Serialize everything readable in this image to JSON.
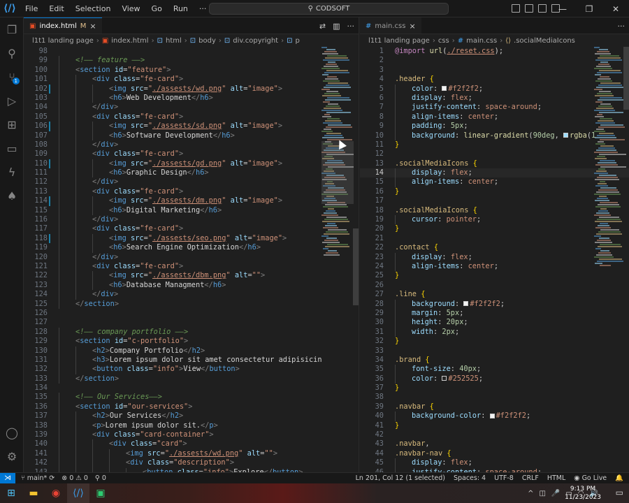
{
  "titlebar": {
    "menu": [
      "File",
      "Edit",
      "Selection",
      "View",
      "Go",
      "Run",
      "···"
    ],
    "search": "CODSOFT",
    "window_controls": [
      "—",
      "❐",
      "✕"
    ]
  },
  "activity": {
    "scm_badge": "1"
  },
  "left_editor": {
    "tab": {
      "label": "index.html",
      "modified": "M"
    },
    "breadcrumbs": [
      "l1t1 landing page",
      "index.html",
      "html",
      "body",
      "div.copyright",
      "p"
    ],
    "lines": [
      {
        "n": "98",
        "html": ""
      },
      {
        "n": "99",
        "html": "<span class='tk-com'>&lt;!—— feature ——&gt;</span>",
        "indent": 1
      },
      {
        "n": "100",
        "html": "<span class='tk-br'>&lt;</span><span class='tk-tag'>section</span> <span class='tk-attr'>id</span>=<span class='tk-str'>\"feature\"</span><span class='tk-br'>&gt;</span>",
        "indent": 1
      },
      {
        "n": "101",
        "html": "<span class='tk-br'>&lt;</span><span class='tk-tag'>div</span> <span class='tk-attr'>class</span>=<span class='tk-str'>\"fe-card\"</span><span class='tk-br'>&gt;</span>",
        "indent": 2
      },
      {
        "n": "102",
        "html": "<span class='tk-br'>&lt;</span><span class='tk-tag'>img</span> <span class='tk-attr'>src</span>=<span class='tk-str'>\"</span><span class='tk-link'>./assests/wd.png</span><span class='tk-str'>\"</span> <span class='tk-attr'>alt</span>=<span class='tk-str'>\"image\"</span><span class='tk-br'>&gt;</span>",
        "indent": 3,
        "mod": true
      },
      {
        "n": "103",
        "html": "<span class='tk-br'>&lt;</span><span class='tk-tag'>h6</span><span class='tk-br'>&gt;</span><span class='tk-text'>Web Development</span><span class='tk-br'>&lt;/</span><span class='tk-tag'>h6</span><span class='tk-br'>&gt;</span>",
        "indent": 3
      },
      {
        "n": "104",
        "html": "<span class='tk-br'>&lt;/</span><span class='tk-tag'>div</span><span class='tk-br'>&gt;</span>",
        "indent": 2
      },
      {
        "n": "105",
        "html": "<span class='tk-br'>&lt;</span><span class='tk-tag'>div</span> <span class='tk-attr'>class</span>=<span class='tk-str'>\"fe-card\"</span><span class='tk-br'>&gt;</span>",
        "indent": 2
      },
      {
        "n": "106",
        "html": "<span class='tk-br'>&lt;</span><span class='tk-tag'>img</span> <span class='tk-attr'>src</span>=<span class='tk-str'>\"</span><span class='tk-link'>./assests/sd.png</span><span class='tk-str'>\"</span> <span class='tk-attr'>alt</span>=<span class='tk-str'>\"image\"</span><span class='tk-br'>&gt;</span>",
        "indent": 3,
        "mod": true
      },
      {
        "n": "107",
        "html": "<span class='tk-br'>&lt;</span><span class='tk-tag'>h6</span><span class='tk-br'>&gt;</span><span class='tk-text'>Software Development</span><span class='tk-br'>&lt;/</span><span class='tk-tag'>h6</span><span class='tk-br'>&gt;</span>",
        "indent": 3
      },
      {
        "n": "108",
        "html": "<span class='tk-br'>&lt;/</span><span class='tk-tag'>div</span><span class='tk-br'>&gt;</span>",
        "indent": 2
      },
      {
        "n": "109",
        "html": "<span class='tk-br'>&lt;</span><span class='tk-tag'>div</span> <span class='tk-attr'>class</span>=<span class='tk-str'>\"fe-card\"</span><span class='tk-br'>&gt;</span>",
        "indent": 2
      },
      {
        "n": "110",
        "html": "<span class='tk-br'>&lt;</span><span class='tk-tag'>img</span> <span class='tk-attr'>src</span>=<span class='tk-str'>\"</span><span class='tk-link'>./assests/gd.png</span><span class='tk-str'>\"</span> <span class='tk-attr'>alt</span>=<span class='tk-str'>\"image\"</span><span class='tk-br'>&gt;</span>",
        "indent": 3,
        "mod": true
      },
      {
        "n": "111",
        "html": "<span class='tk-br'>&lt;</span><span class='tk-tag'>h6</span><span class='tk-br'>&gt;</span><span class='tk-text'>Graphic Design</span><span class='tk-br'>&lt;/</span><span class='tk-tag'>h6</span><span class='tk-br'>&gt;</span>",
        "indent": 3
      },
      {
        "n": "112",
        "html": "<span class='tk-br'>&lt;/</span><span class='tk-tag'>div</span><span class='tk-br'>&gt;</span>",
        "indent": 2
      },
      {
        "n": "113",
        "html": "<span class='tk-br'>&lt;</span><span class='tk-tag'>div</span> <span class='tk-attr'>class</span>=<span class='tk-str'>\"fe-card\"</span><span class='tk-br'>&gt;</span>",
        "indent": 2
      },
      {
        "n": "114",
        "html": "<span class='tk-br'>&lt;</span><span class='tk-tag'>img</span> <span class='tk-attr'>src</span>=<span class='tk-str'>\"</span><span class='tk-link'>./assests/dm.png</span><span class='tk-str'>\"</span> <span class='tk-attr'>alt</span>=<span class='tk-str'>\"image\"</span><span class='tk-br'>&gt;</span>",
        "indent": 3,
        "mod": true
      },
      {
        "n": "115",
        "html": "<span class='tk-br'>&lt;</span><span class='tk-tag'>h6</span><span class='tk-br'>&gt;</span><span class='tk-text'>Digital Marketing</span><span class='tk-br'>&lt;/</span><span class='tk-tag'>h6</span><span class='tk-br'>&gt;</span>",
        "indent": 3
      },
      {
        "n": "116",
        "html": "<span class='tk-br'>&lt;/</span><span class='tk-tag'>div</span><span class='tk-br'>&gt;</span>",
        "indent": 2
      },
      {
        "n": "117",
        "html": "<span class='tk-br'>&lt;</span><span class='tk-tag'>div</span> <span class='tk-attr'>class</span>=<span class='tk-str'>\"fe-card\"</span><span class='tk-br'>&gt;</span>",
        "indent": 2
      },
      {
        "n": "118",
        "html": "<span class='tk-br'>&lt;</span><span class='tk-tag'>img</span> <span class='tk-attr'>src</span>=<span class='tk-str'>\"</span><span class='tk-link'>./assests/seo.png</span><span class='tk-str'>\"</span> <span class='tk-attr'>alt</span>=<span class='tk-str'>\"image\"</span><span class='tk-br'>&gt;</span>",
        "indent": 3,
        "mod": true
      },
      {
        "n": "119",
        "html": "<span class='tk-br'>&lt;</span><span class='tk-tag'>h6</span><span class='tk-br'>&gt;</span><span class='tk-text'>Search Engine Optimization</span><span class='tk-br'>&lt;/</span><span class='tk-tag'>h6</span><span class='tk-br'>&gt;</span>",
        "indent": 3
      },
      {
        "n": "120",
        "html": "<span class='tk-br'>&lt;/</span><span class='tk-tag'>div</span><span class='tk-br'>&gt;</span>",
        "indent": 2
      },
      {
        "n": "121",
        "html": "<span class='tk-br'>&lt;</span><span class='tk-tag'>div</span> <span class='tk-attr'>class</span>=<span class='tk-str'>\"fe-card\"</span><span class='tk-br'>&gt;</span>",
        "indent": 2
      },
      {
        "n": "122",
        "html": "<span class='tk-br'>&lt;</span><span class='tk-tag'>img</span> <span class='tk-attr'>src</span>=<span class='tk-str'>\"</span><span class='tk-link'>./assests/dbm.png</span><span class='tk-str'>\"</span> <span class='tk-attr'>alt</span>=<span class='tk-str'>\"\"</span><span class='tk-br'>&gt;</span>",
        "indent": 3
      },
      {
        "n": "123",
        "html": "<span class='tk-br'>&lt;</span><span class='tk-tag'>h6</span><span class='tk-br'>&gt;</span><span class='tk-text'>Database Managment</span><span class='tk-br'>&lt;/</span><span class='tk-tag'>h6</span><span class='tk-br'>&gt;</span>",
        "indent": 3
      },
      {
        "n": "124",
        "html": "<span class='tk-br'>&lt;/</span><span class='tk-tag'>div</span><span class='tk-br'>&gt;</span>",
        "indent": 2
      },
      {
        "n": "125",
        "html": "<span class='tk-br'>&lt;/</span><span class='tk-tag'>section</span><span class='tk-br'>&gt;</span>",
        "indent": 1
      },
      {
        "n": "126",
        "html": ""
      },
      {
        "n": "127",
        "html": ""
      },
      {
        "n": "128",
        "html": "<span class='tk-com'>&lt;!—— company portfolio ——&gt;</span>",
        "indent": 1
      },
      {
        "n": "129",
        "html": "<span class='tk-br'>&lt;</span><span class='tk-tag'>section</span> <span class='tk-attr'>id</span>=<span class='tk-str'>\"c-portfolio\"</span><span class='tk-br'>&gt;</span>",
        "indent": 1
      },
      {
        "n": "130",
        "html": "<span class='tk-br'>&lt;</span><span class='tk-tag'>h2</span><span class='tk-br'>&gt;</span><span class='tk-text'>Company Portfolio</span><span class='tk-br'>&lt;/</span><span class='tk-tag'>h2</span><span class='tk-br'>&gt;</span>",
        "indent": 2
      },
      {
        "n": "131",
        "html": "<span class='tk-br'>&lt;</span><span class='tk-tag'>h3</span><span class='tk-br'>&gt;</span><span class='tk-text'>Lorem ipsum dolor sit amet consectetur adipisicin</span>",
        "indent": 2
      },
      {
        "n": "132",
        "html": "<span class='tk-br'>&lt;</span><span class='tk-tag'>button</span> <span class='tk-attr'>class</span>=<span class='tk-str'>\"info\"</span><span class='tk-br'>&gt;</span><span class='tk-text'>View</span><span class='tk-br'>&lt;/</span><span class='tk-tag'>button</span><span class='tk-br'>&gt;</span>",
        "indent": 2
      },
      {
        "n": "133",
        "html": "<span class='tk-br'>&lt;/</span><span class='tk-tag'>section</span><span class='tk-br'>&gt;</span>",
        "indent": 1
      },
      {
        "n": "134",
        "html": ""
      },
      {
        "n": "135",
        "html": "<span class='tk-com'>&lt;!—— Our Services——&gt;</span>",
        "indent": 1
      },
      {
        "n": "136",
        "html": "<span class='tk-br'>&lt;</span><span class='tk-tag'>section</span> <span class='tk-attr'>id</span>=<span class='tk-str'>\"our-services\"</span><span class='tk-br'>&gt;</span>",
        "indent": 1
      },
      {
        "n": "137",
        "html": "<span class='tk-br'>&lt;</span><span class='tk-tag'>h2</span><span class='tk-br'>&gt;</span><span class='tk-text'>Our Services</span><span class='tk-br'>&lt;/</span><span class='tk-tag'>h2</span><span class='tk-br'>&gt;</span>",
        "indent": 2
      },
      {
        "n": "138",
        "html": "<span class='tk-br'>&lt;</span><span class='tk-tag'>p</span><span class='tk-br'>&gt;</span><span class='tk-text'>Lorem ipsum dolor sit.</span><span class='tk-br'>&lt;/</span><span class='tk-tag'>p</span><span class='tk-br'>&gt;</span>",
        "indent": 2
      },
      {
        "n": "139",
        "html": "<span class='tk-br'>&lt;</span><span class='tk-tag'>div</span> <span class='tk-attr'>class</span>=<span class='tk-str'>\"card-container\"</span><span class='tk-br'>&gt;</span>",
        "indent": 2
      },
      {
        "n": "140",
        "html": "<span class='tk-br'>&lt;</span><span class='tk-tag'>div</span> <span class='tk-attr'>class</span>=<span class='tk-str'>\"card\"</span><span class='tk-br'>&gt;</span>",
        "indent": 3
      },
      {
        "n": "141",
        "html": "<span class='tk-br'>&lt;</span><span class='tk-tag'>img</span> <span class='tk-attr'>src</span>=<span class='tk-str'>\"</span><span class='tk-link'>./assests/wd.png</span><span class='tk-str'>\"</span> <span class='tk-attr'>alt</span>=<span class='tk-str'>\"\"</span><span class='tk-br'>&gt;</span>",
        "indent": 4
      },
      {
        "n": "142",
        "html": "<span class='tk-br'>&lt;</span><span class='tk-tag'>div</span> <span class='tk-attr'>class</span>=<span class='tk-str'>\"description\"</span><span class='tk-br'>&gt;</span>",
        "indent": 4
      },
      {
        "n": "143",
        "html": "<span class='tk-br'>&lt;</span><span class='tk-tag'>button</span> <span class='tk-attr'>class</span>=<span class='tk-str'>\"info\"</span><span class='tk-br'>&gt;</span><span class='tk-text'>Explore</span><span class='tk-br'>&lt;/</span><span class='tk-tag'>button</span><span class='tk-br'>&gt;</span>",
        "indent": 5
      }
    ]
  },
  "right_editor": {
    "tab": {
      "label": "main.css"
    },
    "breadcrumbs": [
      "l1t1 landing page",
      "css",
      "main.css",
      ".socialMediaIcons"
    ],
    "lines": [
      {
        "n": "1",
        "html": "<span class='tk-at'>@import</span> <span class='tk-fn'>url</span><span class='tk-punc'>(</span><span class='tk-link'>./reset.css</span><span class='tk-punc'>);</span>"
      },
      {
        "n": "2",
        "html": ""
      },
      {
        "n": "3",
        "html": ""
      },
      {
        "n": "4",
        "html": "<span class='tk-sel'>.header</span> <span class='tk-brace'>{</span>"
      },
      {
        "n": "5",
        "html": "<span class='tk-prop'>color</span>: <span class='swatch' style='background:#f2f2f2'></span><span class='tk-val'>#f2f2f2</span>;",
        "indent": 1
      },
      {
        "n": "6",
        "html": "<span class='tk-prop'>display</span>: <span class='tk-val'>flex</span>;",
        "indent": 1
      },
      {
        "n": "7",
        "html": "<span class='tk-prop'>justify-content</span>: <span class='tk-val'>space-around</span>;",
        "indent": 1
      },
      {
        "n": "8",
        "html": "<span class='tk-prop'>align-items</span>: <span class='tk-val'>center</span>;",
        "indent": 1
      },
      {
        "n": "9",
        "html": "<span class='tk-prop'>padding</span>: <span class='tk-num'>5px</span>;",
        "indent": 1
      },
      {
        "n": "10",
        "html": "<span class='tk-prop'>background</span>: <span class='tk-fn'>linear-gradient</span>(<span class='tk-num'>90deg</span>, <span class='swatch' style='background:#9cdcfe'></span><span class='tk-fn'>rgba</span>(<span class='tk-num'>1</span>",
        "indent": 1
      },
      {
        "n": "11",
        "html": "<span class='tk-brace'>}</span>"
      },
      {
        "n": "12",
        "html": ""
      },
      {
        "n": "13",
        "html": "<span class='tk-sel'>.socialMediaIcons</span> <span class='tk-brace'>{</span>"
      },
      {
        "n": "14",
        "html": "<span class='tk-prop'>display</span>: <span class='tk-val'>flex</span>;",
        "indent": 1,
        "current": true
      },
      {
        "n": "15",
        "html": "<span class='tk-prop'>align-items</span>: <span class='tk-val'>center</span>;",
        "indent": 1
      },
      {
        "n": "16",
        "html": "<span class='tk-brace'>}</span>"
      },
      {
        "n": "17",
        "html": ""
      },
      {
        "n": "18",
        "html": "<span class='tk-sel'>.socialMediaIcons</span> <span class='tk-brace'>{</span>"
      },
      {
        "n": "19",
        "html": "<span class='tk-prop'>cursor</span>: <span class='tk-val'>pointer</span>;",
        "indent": 1
      },
      {
        "n": "20",
        "html": "<span class='tk-brace'>}</span>"
      },
      {
        "n": "21",
        "html": ""
      },
      {
        "n": "22",
        "html": "<span class='tk-sel'>.contact</span> <span class='tk-brace'>{</span>"
      },
      {
        "n": "23",
        "html": "<span class='tk-prop'>display</span>: <span class='tk-val'>flex</span>;",
        "indent": 1
      },
      {
        "n": "24",
        "html": "<span class='tk-prop'>align-items</span>: <span class='tk-val'>center</span>;",
        "indent": 1
      },
      {
        "n": "25",
        "html": "<span class='tk-brace'>}</span>"
      },
      {
        "n": "26",
        "html": ""
      },
      {
        "n": "27",
        "html": "<span class='tk-sel'>.line</span> <span class='tk-brace'>{</span>"
      },
      {
        "n": "28",
        "html": "<span class='tk-prop'>background</span>: <span class='swatch' style='background:#f2f2f2'></span><span class='tk-val'>#f2f2f2</span>;",
        "indent": 1
      },
      {
        "n": "29",
        "html": "<span class='tk-prop'>margin</span>: <span class='tk-num'>5px</span>;",
        "indent": 1
      },
      {
        "n": "30",
        "html": "<span class='tk-prop'>height</span>: <span class='tk-num'>20px</span>;",
        "indent": 1
      },
      {
        "n": "31",
        "html": "<span class='tk-prop'>width</span>: <span class='tk-num'>2px</span>;",
        "indent": 1
      },
      {
        "n": "32",
        "html": "<span class='tk-brace'>}</span>"
      },
      {
        "n": "33",
        "html": ""
      },
      {
        "n": "34",
        "html": "<span class='tk-sel'>.brand</span> <span class='tk-brace'>{</span>"
      },
      {
        "n": "35",
        "html": "<span class='tk-prop'>font-size</span>: <span class='tk-num'>40px</span>;",
        "indent": 1
      },
      {
        "n": "36",
        "html": "<span class='tk-prop'>color</span>: <span class='swatch' style='background:#252525'></span><span class='tk-val'>#252525</span>;",
        "indent": 1
      },
      {
        "n": "37",
        "html": "<span class='tk-brace'>}</span>"
      },
      {
        "n": "38",
        "html": ""
      },
      {
        "n": "39",
        "html": "<span class='tk-sel'>.navbar</span> <span class='tk-brace'>{</span>"
      },
      {
        "n": "40",
        "html": "<span class='tk-prop'>background-color</span>: <span class='swatch' style='background:#f2f2f2'></span><span class='tk-val'>#f2f2f2</span>;",
        "indent": 1
      },
      {
        "n": "41",
        "html": "<span class='tk-brace'>}</span>"
      },
      {
        "n": "42",
        "html": ""
      },
      {
        "n": "43",
        "html": "<span class='tk-sel'>.navbar</span>,"
      },
      {
        "n": "44",
        "html": "<span class='tk-sel'>.navbar-nav</span> <span class='tk-brace'>{</span>"
      },
      {
        "n": "45",
        "html": "<span class='tk-prop'>display</span>: <span class='tk-val'>flex</span>;",
        "indent": 1
      },
      {
        "n": "46",
        "html": "<span class='tk-prop'>justify-content</span>: <span class='tk-val'>space-around</span>;",
        "indent": 1
      }
    ]
  },
  "statusbar": {
    "branch": "main*",
    "errors": "0",
    "warnings": "0",
    "ports": "0",
    "position": "Ln 201, Col 12 (1 selected)",
    "spaces": "Spaces: 4",
    "encoding": "UTF-8",
    "eol": "CRLF",
    "language": "HTML",
    "golive": "Go Live"
  },
  "taskbar": {
    "time": "9:13 PM",
    "date": "11/23/2023"
  },
  "colors": {
    "accent": "#0078d4"
  }
}
